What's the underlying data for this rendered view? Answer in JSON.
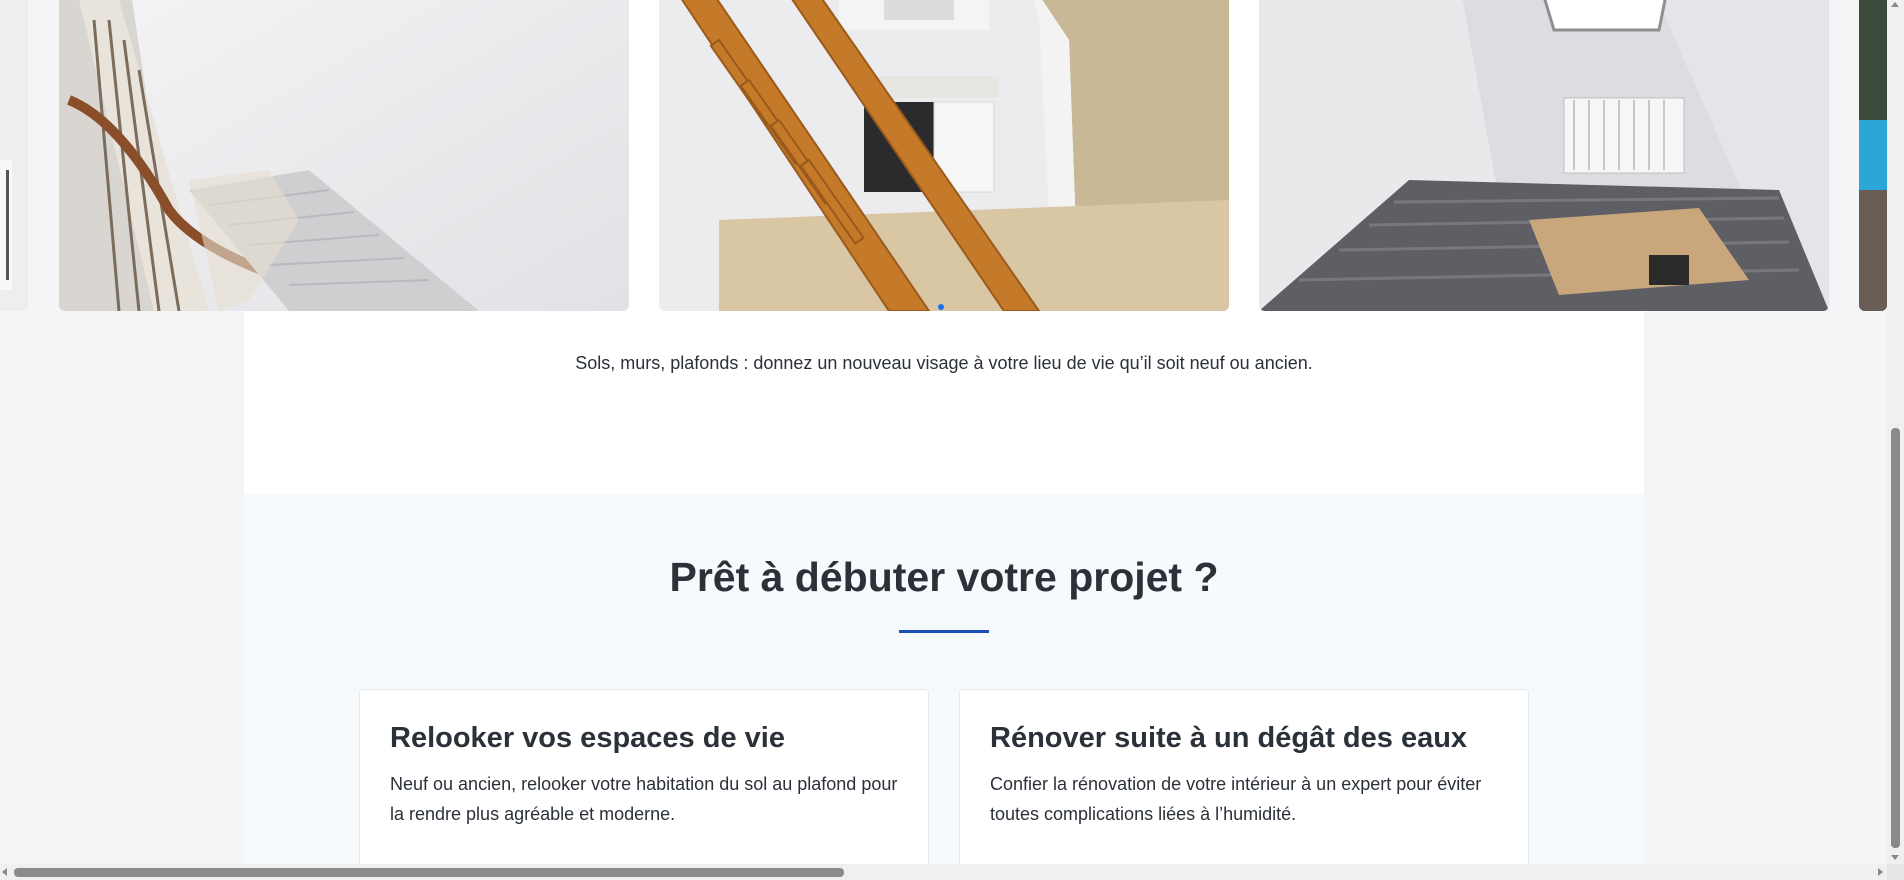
{
  "carousel": {
    "slides": [
      {
        "name": "partial-left",
        "alt": ""
      },
      {
        "name": "stairwell",
        "alt": ""
      },
      {
        "name": "kitchen-stairs",
        "alt": ""
      },
      {
        "name": "attic-room",
        "alt": ""
      },
      {
        "name": "partial-right",
        "alt": ""
      }
    ],
    "active_dot": 0,
    "dot_count": 1
  },
  "tagline": "Sols, murs, plafonds : donnez un nouveau visage à votre lieu de vie qu’il soit neuf ou ancien.",
  "cta": {
    "title": "Prêt à débuter votre projet ?",
    "cards": [
      {
        "title": "Relooker vos espaces de vie",
        "text": "Neuf ou ancien, relooker votre habitation du sol au plafond pour la rendre plus agréable et moderne."
      },
      {
        "title": "Rénover suite à un dégât des eaux",
        "text": "Confier la rénovation de votre intérieur à un expert pour éviter toutes complications liées à l’humidité."
      }
    ]
  },
  "colors": {
    "accent": "#1a4fb6",
    "dot_active": "#1a73e8",
    "text": "#2b3139",
    "section_bg": "#f7fafc"
  }
}
